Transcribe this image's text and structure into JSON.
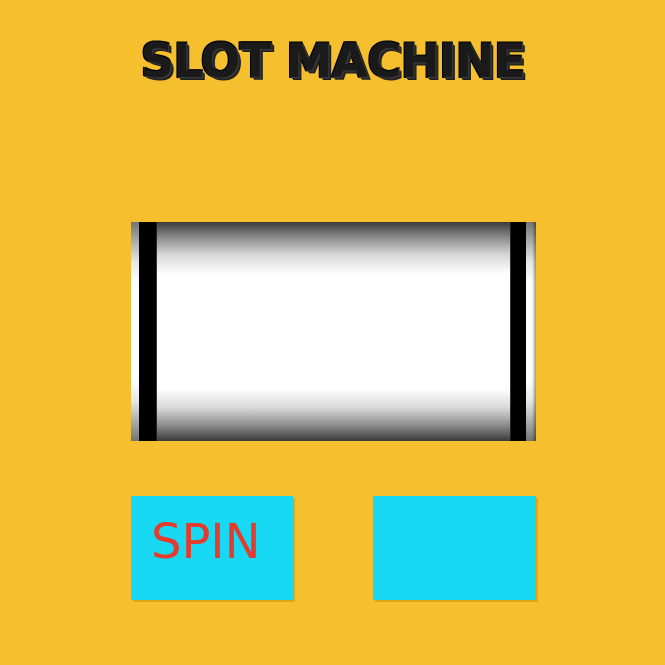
{
  "game": {
    "title": "SLOT MACHINE"
  },
  "reel": {
    "symbols": []
  },
  "controls": {
    "spin_label": "SPIN",
    "second_label": ""
  },
  "colors": {
    "background": "#f6bf2e",
    "button": "#17d9f3",
    "spin_text": "#e53b2c",
    "title_text": "#1a1a1a"
  }
}
